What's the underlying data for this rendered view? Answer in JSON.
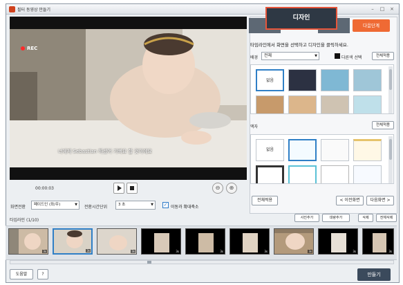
{
  "window": {
    "title": "필터 동영상 만들기",
    "controls": [
      "–",
      "□",
      "×"
    ]
  },
  "preview": {
    "rec_label": "REC",
    "subtitle": "너에게 Sebastian 하셨어 기뻐요 할 것이예요",
    "time": "00:00:03"
  },
  "options": {
    "transition_label": "화면전환",
    "transition_value": "페이드인 (좌/우)",
    "duration_label": "전환시간단위",
    "duration_value": "3 초",
    "apply_label": "이동과 확대축소",
    "apply_checked": true
  },
  "tabs": {
    "tab1": "",
    "active": "디자인",
    "tab3": "",
    "next": "다음단계"
  },
  "design": {
    "instruction": "타임라인에서 화면을 선택하고 디자인을 클릭하세요.",
    "background_label": "배경",
    "background_select": "전체",
    "other_color_label": "다른색 선택",
    "apply_all_1": "전체적용",
    "none_label": "없음",
    "frame_label": "액자",
    "apply_all_2": "전체적용",
    "frame_none_label": "없음",
    "apply_all_3": "전체적용",
    "prev_screen": "< 이전화면",
    "next_screen": "다음화면 >"
  },
  "timeline": {
    "label": "타임라인 (1/10)",
    "buttons": [
      "사진추가",
      "대량추가",
      "삭제",
      "전체삭제"
    ],
    "clip_times": [
      "3s",
      "3s",
      "3s",
      "3s",
      "3s",
      "3s",
      "3s",
      "3s",
      "3s"
    ]
  },
  "footer": {
    "help": "도움말",
    "question": "?",
    "make": "만들기"
  },
  "colors": {
    "accent": "#e7553a",
    "next": "#ef6a34",
    "tab": "#2e3844",
    "select": "#2f7fc6"
  },
  "icons": {
    "play": "play-icon",
    "stop": "stop-icon",
    "zoom_in": "zoom-in-icon",
    "zoom_out": "zoom-out-icon",
    "check": "check-icon"
  }
}
